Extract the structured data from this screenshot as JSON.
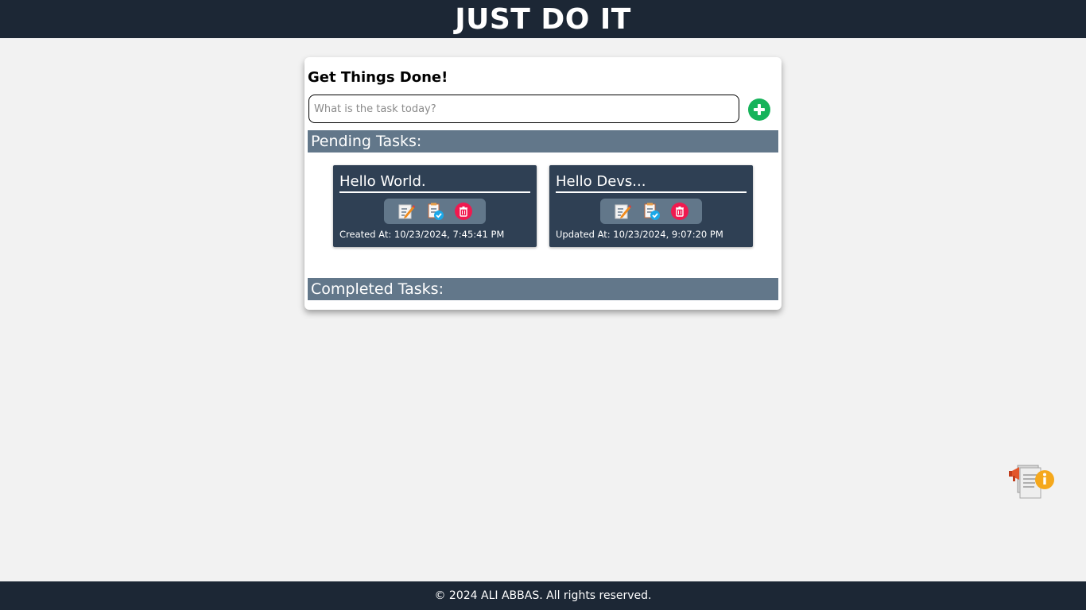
{
  "header": {
    "title": "JUST DO IT"
  },
  "main": {
    "heading": "Get Things Done!",
    "input": {
      "placeholder": "What is the task today?",
      "value": ""
    },
    "add_icon": "plus-circle-icon",
    "pending_label": "Pending Tasks:",
    "completed_label": "Completed Tasks:",
    "pending_tasks": [
      {
        "title": "Hello World.",
        "meta": "Created At: 10/23/2024, 7:45:41 PM",
        "actions": [
          "edit-icon",
          "complete-icon",
          "delete-icon"
        ]
      },
      {
        "title": "Hello Devs...",
        "meta": "Updated At: 10/23/2024, 9:07:20 PM",
        "actions": [
          "edit-icon",
          "complete-icon",
          "delete-icon"
        ]
      }
    ],
    "completed_tasks": []
  },
  "floating": {
    "icon": "announcement-info-icon"
  },
  "footer": {
    "text": "© 2024 ALI ABBAS. All rights reserved."
  },
  "colors": {
    "header_bg": "#1c2735",
    "page_bg": "#f2f2f2",
    "section_bar": "#62778a",
    "task_card": "#2f4054",
    "add_button": "#16b35a",
    "delete_button": "#f0194f"
  }
}
